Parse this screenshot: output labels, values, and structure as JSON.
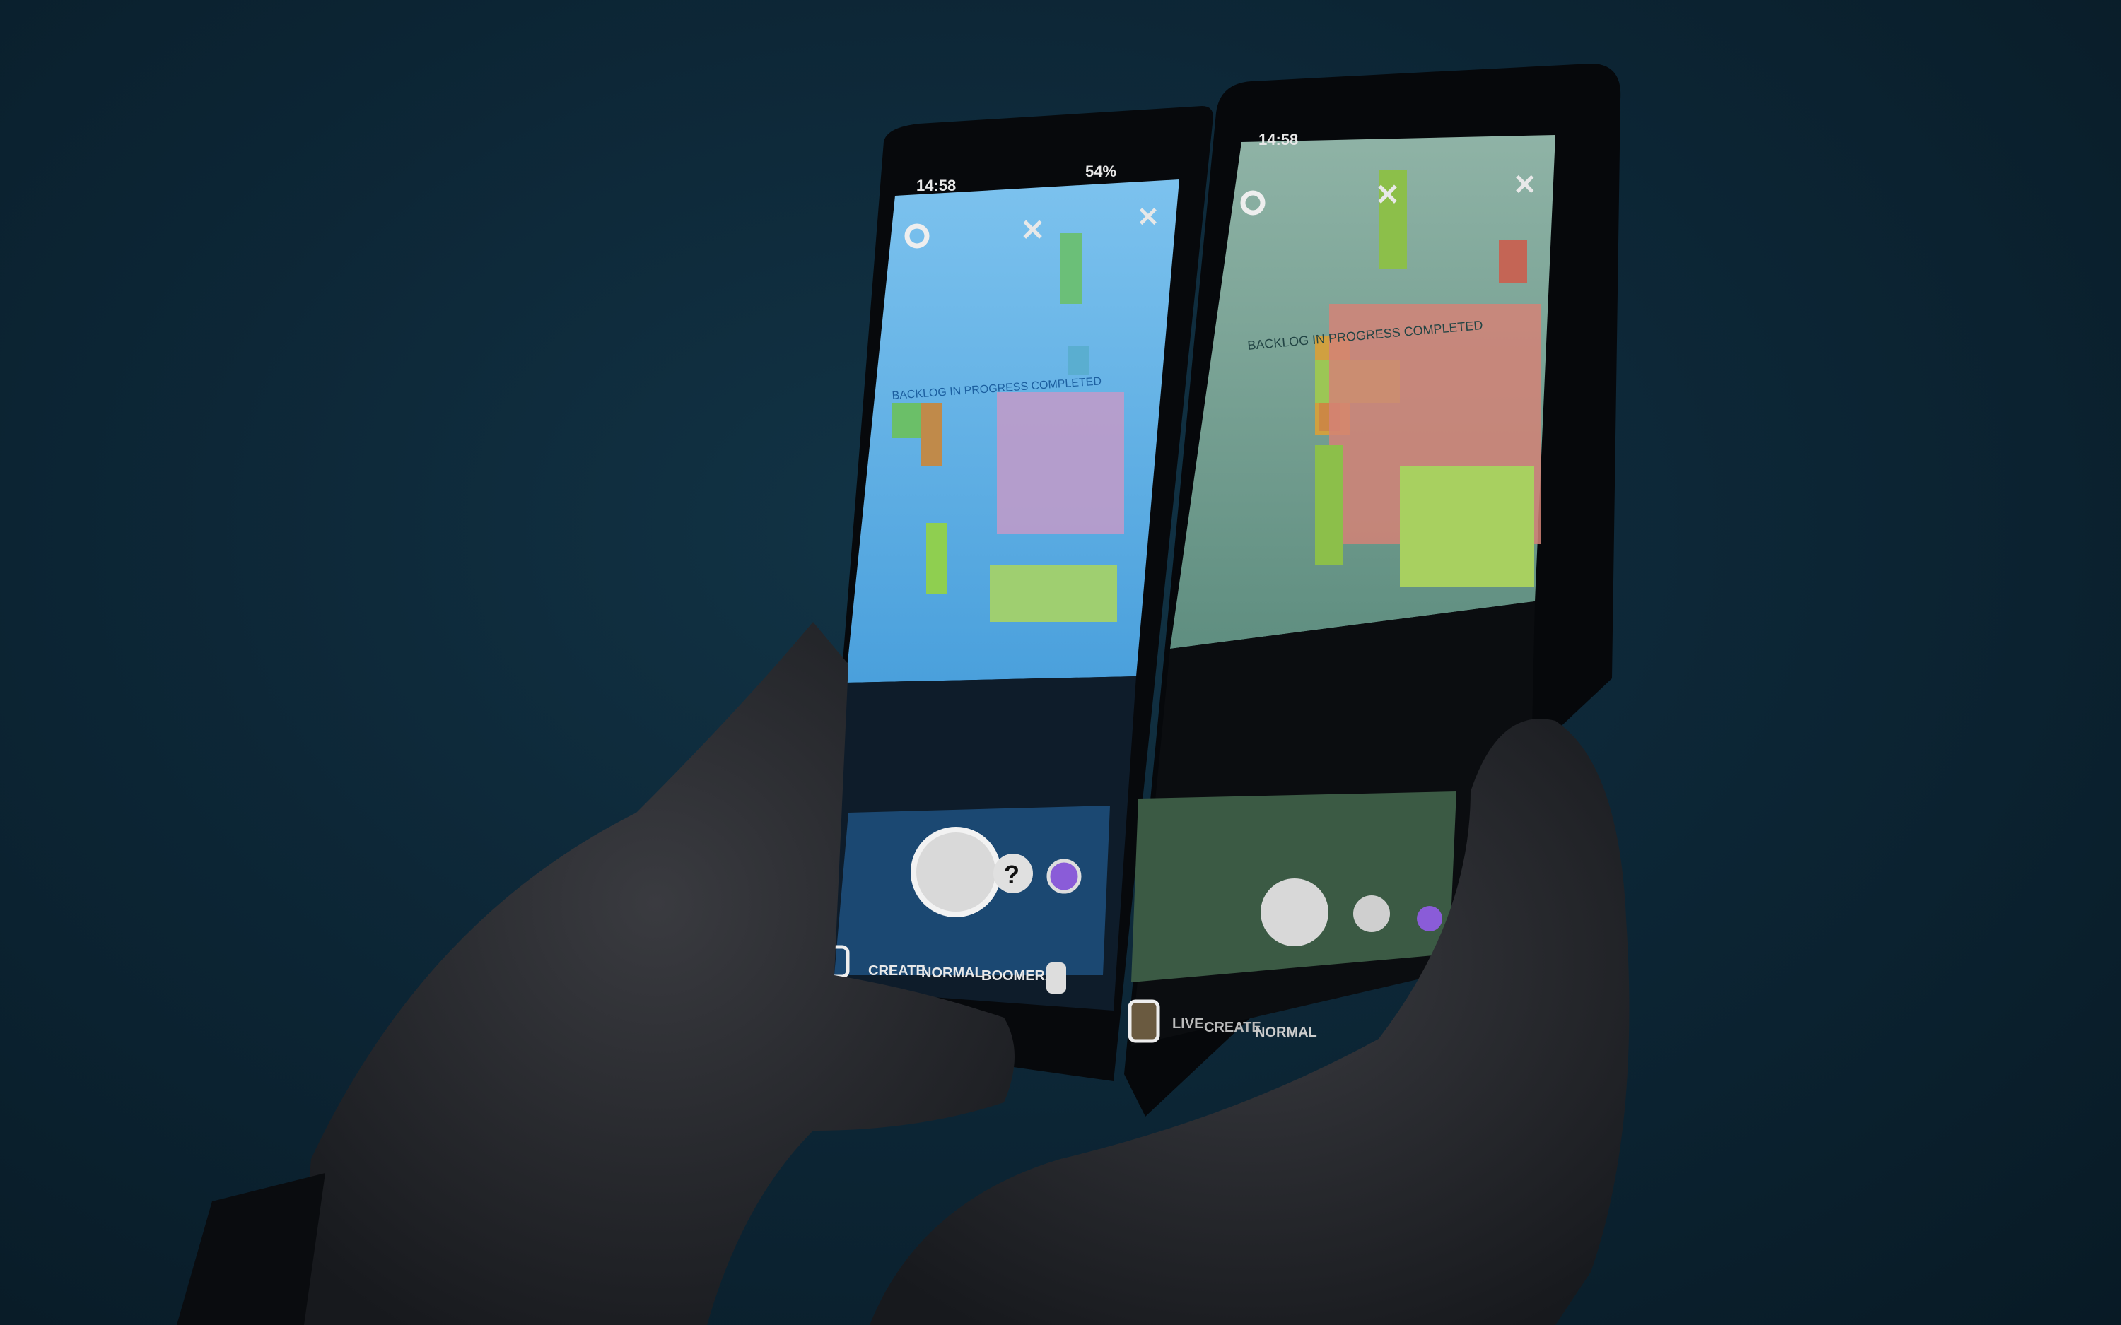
{
  "left_phone": {
    "status_time": "14:58",
    "status_battery": "54%",
    "board_headers": "BACKLOG IN PROGRESS COMPLETED",
    "modes": [
      "CREATE",
      "NORMAL",
      "BOOMERA"
    ],
    "icons": [
      "settings-icon",
      "flash-off-icon",
      "close-icon",
      "effect-question-icon",
      "flip-camera-icon",
      "gallery-icon"
    ],
    "screen_tint": "#63b3e6"
  },
  "right_phone": {
    "status_time": "14:58",
    "board_headers": "BACKLOG IN PROGRESS COMPLETED",
    "modes": [
      "LIVE",
      "CREATE",
      "NORMAL"
    ],
    "icons": [
      "settings-icon",
      "flash-off-icon",
      "close-icon",
      "effect-question-icon",
      "gallery-icon"
    ],
    "screen_tint": "#6a9a8c"
  }
}
